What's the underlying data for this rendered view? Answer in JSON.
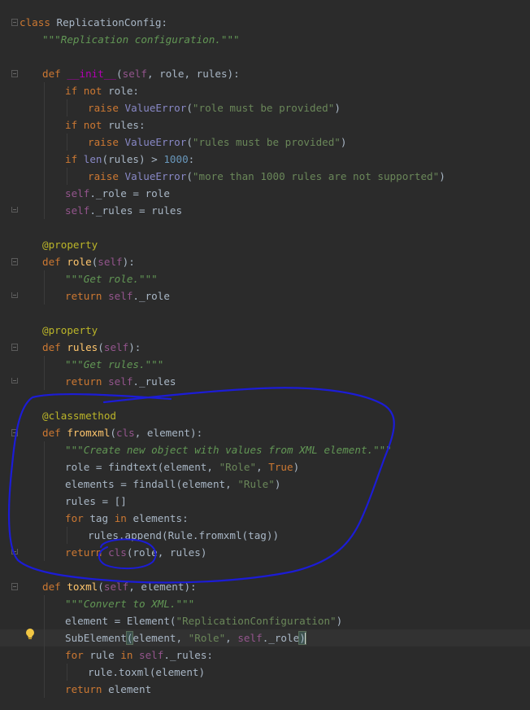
{
  "editor": {
    "lines": [
      {
        "n": 1,
        "indent": 0,
        "tokens": [
          {
            "t": "class ",
            "c": "kw"
          },
          {
            "t": "ReplicationConfig",
            "c": "ident"
          },
          {
            "t": ":",
            "c": "ident"
          }
        ]
      },
      {
        "n": 2,
        "indent": 1,
        "tokens": [
          {
            "t": "\"\"\"Replication configuration.\"\"\"",
            "c": "doc"
          }
        ]
      },
      {
        "n": 3,
        "indent": 0,
        "tokens": []
      },
      {
        "n": 4,
        "indent": 1,
        "tokens": [
          {
            "t": "def ",
            "c": "kw"
          },
          {
            "t": "__init__",
            "c": "magic"
          },
          {
            "t": "(",
            "c": "ident"
          },
          {
            "t": "self",
            "c": "self"
          },
          {
            "t": ", role, rules):",
            "c": "ident"
          }
        ]
      },
      {
        "n": 5,
        "indent": 2,
        "tokens": [
          {
            "t": "if not ",
            "c": "kw"
          },
          {
            "t": "role:",
            "c": "ident"
          }
        ]
      },
      {
        "n": 6,
        "indent": 3,
        "tokens": [
          {
            "t": "raise ",
            "c": "kw"
          },
          {
            "t": "ValueError",
            "c": "bi"
          },
          {
            "t": "(",
            "c": "ident"
          },
          {
            "t": "\"role must be provided\"",
            "c": "str"
          },
          {
            "t": ")",
            "c": "ident"
          }
        ]
      },
      {
        "n": 7,
        "indent": 2,
        "tokens": [
          {
            "t": "if not ",
            "c": "kw"
          },
          {
            "t": "rules:",
            "c": "ident"
          }
        ]
      },
      {
        "n": 8,
        "indent": 3,
        "tokens": [
          {
            "t": "raise ",
            "c": "kw"
          },
          {
            "t": "ValueError",
            "c": "bi"
          },
          {
            "t": "(",
            "c": "ident"
          },
          {
            "t": "\"rules must be provided\"",
            "c": "str"
          },
          {
            "t": ")",
            "c": "ident"
          }
        ]
      },
      {
        "n": 9,
        "indent": 2,
        "tokens": [
          {
            "t": "if ",
            "c": "kw"
          },
          {
            "t": "len",
            "c": "bi"
          },
          {
            "t": "(rules) > ",
            "c": "ident"
          },
          {
            "t": "1000",
            "c": "num"
          },
          {
            "t": ":",
            "c": "ident"
          }
        ]
      },
      {
        "n": 10,
        "indent": 3,
        "tokens": [
          {
            "t": "raise ",
            "c": "kw"
          },
          {
            "t": "ValueError",
            "c": "bi"
          },
          {
            "t": "(",
            "c": "ident"
          },
          {
            "t": "\"more than 1000 rules are not supported\"",
            "c": "str"
          },
          {
            "t": ")",
            "c": "ident"
          }
        ]
      },
      {
        "n": 11,
        "indent": 2,
        "tokens": [
          {
            "t": "self",
            "c": "self"
          },
          {
            "t": "._role = role",
            "c": "ident"
          }
        ]
      },
      {
        "n": 12,
        "indent": 2,
        "tokens": [
          {
            "t": "self",
            "c": "self"
          },
          {
            "t": "._rules = rules",
            "c": "ident"
          }
        ]
      },
      {
        "n": 13,
        "indent": 0,
        "tokens": []
      },
      {
        "n": 14,
        "indent": 1,
        "tokens": [
          {
            "t": "@property",
            "c": "dec"
          }
        ]
      },
      {
        "n": 15,
        "indent": 1,
        "tokens": [
          {
            "t": "def ",
            "c": "kw"
          },
          {
            "t": "role",
            "c": "fn"
          },
          {
            "t": "(",
            "c": "ident"
          },
          {
            "t": "self",
            "c": "self"
          },
          {
            "t": "):",
            "c": "ident"
          }
        ]
      },
      {
        "n": 16,
        "indent": 2,
        "tokens": [
          {
            "t": "\"\"\"Get role.\"\"\"",
            "c": "doc"
          }
        ]
      },
      {
        "n": 17,
        "indent": 2,
        "tokens": [
          {
            "t": "return ",
            "c": "kw"
          },
          {
            "t": "self",
            "c": "self"
          },
          {
            "t": "._role",
            "c": "ident"
          }
        ]
      },
      {
        "n": 18,
        "indent": 0,
        "tokens": []
      },
      {
        "n": 19,
        "indent": 1,
        "tokens": [
          {
            "t": "@property",
            "c": "dec"
          }
        ]
      },
      {
        "n": 20,
        "indent": 1,
        "tokens": [
          {
            "t": "def ",
            "c": "kw"
          },
          {
            "t": "rules",
            "c": "fn"
          },
          {
            "t": "(",
            "c": "ident"
          },
          {
            "t": "self",
            "c": "self"
          },
          {
            "t": "):",
            "c": "ident"
          }
        ]
      },
      {
        "n": 21,
        "indent": 2,
        "tokens": [
          {
            "t": "\"\"\"Get rules.\"\"\"",
            "c": "doc"
          }
        ]
      },
      {
        "n": 22,
        "indent": 2,
        "tokens": [
          {
            "t": "return ",
            "c": "kw"
          },
          {
            "t": "self",
            "c": "self"
          },
          {
            "t": "._rules",
            "c": "ident"
          }
        ]
      },
      {
        "n": 23,
        "indent": 0,
        "tokens": []
      },
      {
        "n": 24,
        "indent": 1,
        "tokens": [
          {
            "t": "@classmethod",
            "c": "dec"
          }
        ]
      },
      {
        "n": 25,
        "indent": 1,
        "tokens": [
          {
            "t": "def ",
            "c": "kw"
          },
          {
            "t": "fromxml",
            "c": "fn"
          },
          {
            "t": "(",
            "c": "ident"
          },
          {
            "t": "cls",
            "c": "self"
          },
          {
            "t": ", element):",
            "c": "ident"
          }
        ]
      },
      {
        "n": 26,
        "indent": 2,
        "tokens": [
          {
            "t": "\"\"\"Create new object with values from XML element.\"\"\"",
            "c": "doc"
          }
        ]
      },
      {
        "n": 27,
        "indent": 2,
        "tokens": [
          {
            "t": "role = findtext(element, ",
            "c": "ident"
          },
          {
            "t": "\"Role\"",
            "c": "str"
          },
          {
            "t": ", ",
            "c": "ident"
          },
          {
            "t": "True",
            "c": "kw"
          },
          {
            "t": ")",
            "c": "ident"
          }
        ]
      },
      {
        "n": 28,
        "indent": 2,
        "tokens": [
          {
            "t": "elements = findall(element, ",
            "c": "ident"
          },
          {
            "t": "\"Rule\"",
            "c": "str"
          },
          {
            "t": ")",
            "c": "ident"
          }
        ]
      },
      {
        "n": 29,
        "indent": 2,
        "tokens": [
          {
            "t": "rules = []",
            "c": "ident"
          }
        ]
      },
      {
        "n": 30,
        "indent": 2,
        "tokens": [
          {
            "t": "for ",
            "c": "kw"
          },
          {
            "t": "tag ",
            "c": "ident"
          },
          {
            "t": "in ",
            "c": "kw"
          },
          {
            "t": "elements:",
            "c": "ident"
          }
        ]
      },
      {
        "n": 31,
        "indent": 3,
        "tokens": [
          {
            "t": "rules.append(Rule.fromxml(tag))",
            "c": "ident"
          }
        ]
      },
      {
        "n": 32,
        "indent": 2,
        "tokens": [
          {
            "t": "return ",
            "c": "kw"
          },
          {
            "t": "cls",
            "c": "self"
          },
          {
            "t": "(role, rules)",
            "c": "ident"
          }
        ]
      },
      {
        "n": 33,
        "indent": 0,
        "tokens": []
      },
      {
        "n": 34,
        "indent": 1,
        "tokens": [
          {
            "t": "def ",
            "c": "kw"
          },
          {
            "t": "toxml",
            "c": "fn"
          },
          {
            "t": "(",
            "c": "ident"
          },
          {
            "t": "self",
            "c": "self"
          },
          {
            "t": ", element):",
            "c": "ident"
          }
        ]
      },
      {
        "n": 35,
        "indent": 2,
        "tokens": [
          {
            "t": "\"\"\"Convert to XML.\"\"\"",
            "c": "doc"
          }
        ]
      },
      {
        "n": 36,
        "indent": 2,
        "tokens": [
          {
            "t": "element = Element(",
            "c": "ident"
          },
          {
            "t": "\"ReplicationConfiguration\"",
            "c": "str"
          },
          {
            "t": ")",
            "c": "ident"
          }
        ]
      },
      {
        "n": 37,
        "indent": 2,
        "current": true,
        "tokens": [
          {
            "t": "SubElement",
            "c": "ident"
          },
          {
            "t": "(",
            "c": "brace"
          },
          {
            "t": "element, ",
            "c": "ident"
          },
          {
            "t": "\"Role\"",
            "c": "str"
          },
          {
            "t": ", ",
            "c": "ident"
          },
          {
            "t": "self",
            "c": "self"
          },
          {
            "t": "._role",
            "c": "ident"
          },
          {
            "t": ")",
            "c": "brace"
          }
        ]
      },
      {
        "n": 38,
        "indent": 2,
        "tokens": [
          {
            "t": "for ",
            "c": "kw"
          },
          {
            "t": "rule ",
            "c": "ident"
          },
          {
            "t": "in ",
            "c": "kw"
          },
          {
            "t": "self",
            "c": "self"
          },
          {
            "t": "._rules:",
            "c": "ident"
          }
        ]
      },
      {
        "n": 39,
        "indent": 3,
        "tokens": [
          {
            "t": "rule.toxml(element)",
            "c": "ident"
          }
        ]
      },
      {
        "n": 40,
        "indent": 2,
        "tokens": [
          {
            "t": "return ",
            "c": "kw"
          },
          {
            "t": "element",
            "c": "ident"
          }
        ]
      }
    ]
  },
  "colors": {
    "background": "#2b2b2b",
    "annotation": "#1c1cd6"
  },
  "icons": {
    "intention": "lightbulb-icon",
    "fold": "fold-marker-icon"
  }
}
